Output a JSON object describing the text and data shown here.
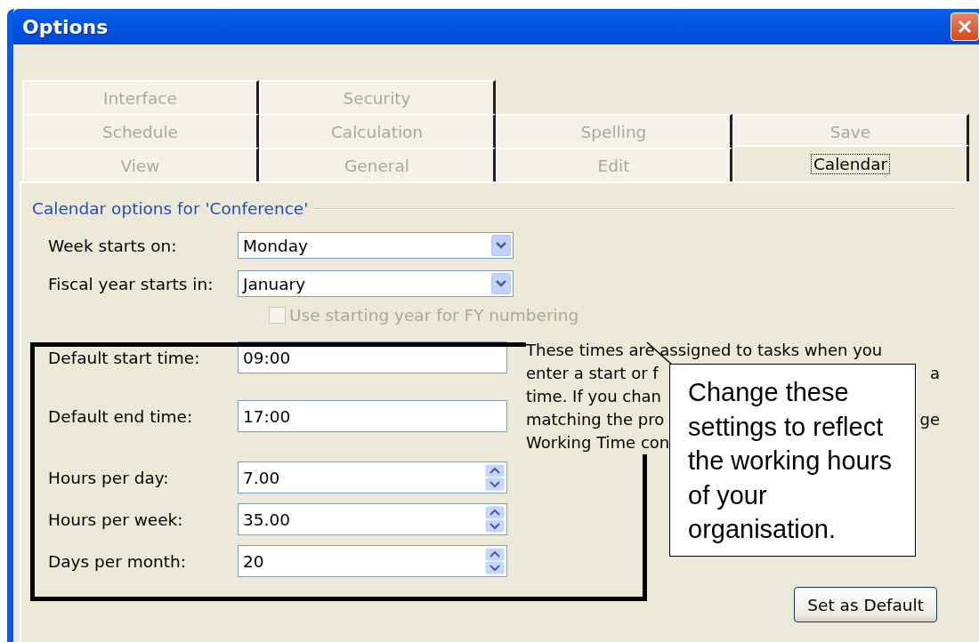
{
  "window": {
    "title": "Options"
  },
  "tab_rows": [
    [
      {
        "label": "Interface",
        "selected": false
      },
      {
        "label": "Security",
        "selected": false
      }
    ],
    [
      {
        "label": "Schedule",
        "selected": false
      },
      {
        "label": "Calculation",
        "selected": false
      },
      {
        "label": "Spelling",
        "selected": false
      },
      {
        "label": "Save",
        "selected": false
      }
    ],
    [
      {
        "label": "View",
        "selected": false
      },
      {
        "label": "General",
        "selected": false
      },
      {
        "label": "Edit",
        "selected": false
      },
      {
        "label": "Calendar",
        "selected": true
      }
    ]
  ],
  "group": {
    "title": "Calendar options for 'Conference'"
  },
  "dropdowns": [
    {
      "label": "Week starts on:",
      "value": "Monday"
    },
    {
      "label": "Fiscal year starts in:",
      "value": "January"
    }
  ],
  "fy_checkbox": {
    "label": "Use starting year for FY numbering",
    "checked": false,
    "disabled": true
  },
  "fields": [
    {
      "label": "Default start time:",
      "value": "09:00",
      "kind": "text"
    },
    {
      "label": "Default end time:",
      "value": "17:00",
      "kind": "text"
    },
    {
      "label": "Hours per day:",
      "value": "7.00",
      "kind": "spin"
    },
    {
      "label": "Hours per week:",
      "value": "35.00",
      "kind": "spin"
    },
    {
      "label": "Days per month:",
      "value": "20",
      "kind": "spin"
    }
  ],
  "description_lines": [
    {
      "left": "These times are assigned to tasks when you"
    },
    {
      "left": "enter a start or f",
      "right": "a"
    },
    {
      "left": "time. If you chan"
    },
    {
      "left": "matching the pro",
      "right": "ge"
    },
    {
      "left": "Working Time con"
    }
  ],
  "callout": {
    "text": "Change these settings to reflect the working hours of your organisation."
  },
  "buttons": [
    {
      "label": "Set as Default"
    }
  ]
}
